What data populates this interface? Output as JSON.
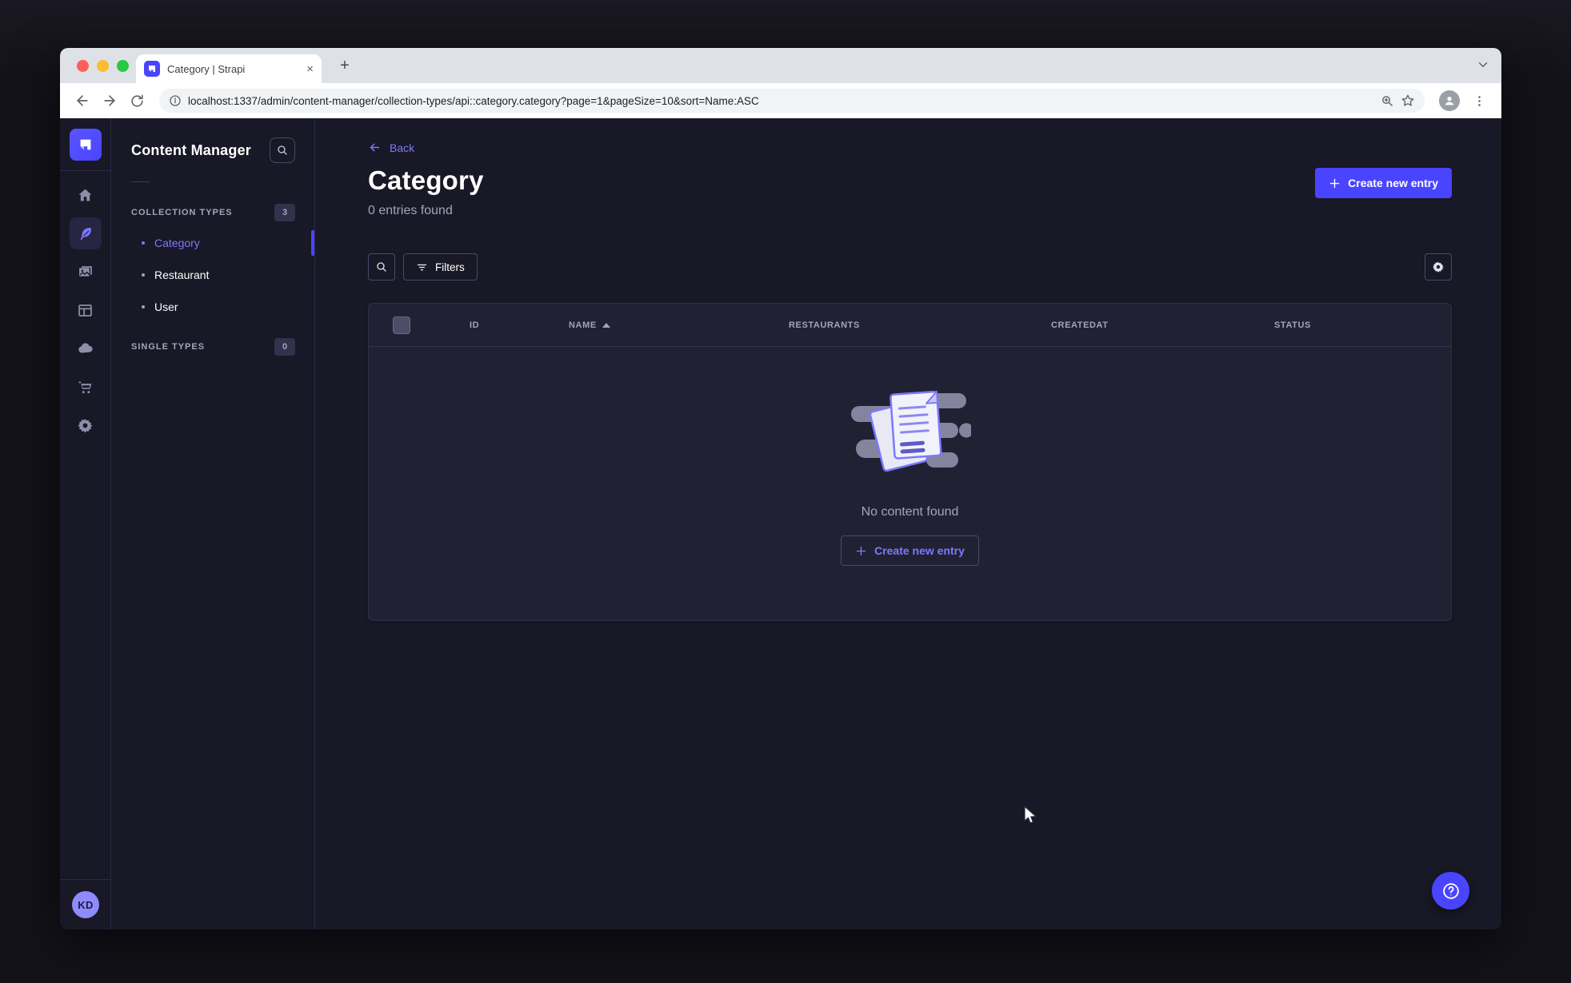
{
  "browser": {
    "tab_title": "Category | Strapi",
    "tab_close": "×",
    "new_tab": "+",
    "url": "localhost:1337/admin/content-manager/collection-types/api::category.category?page=1&pageSize=10&sort=Name:ASC"
  },
  "sidebar": {
    "icons": [
      "strapi-logo",
      "home",
      "content-manager",
      "media-library",
      "content-type-builder",
      "cloud",
      "marketplace",
      "settings"
    ],
    "user_initials": "KD"
  },
  "subnav": {
    "title": "Content Manager",
    "collection_types": {
      "label": "COLLECTION TYPES",
      "count": "3",
      "items": [
        {
          "label": "Category",
          "active": true
        },
        {
          "label": "Restaurant",
          "active": false
        },
        {
          "label": "User",
          "active": false
        }
      ]
    },
    "single_types": {
      "label": "SINGLE TYPES",
      "count": "0"
    }
  },
  "main": {
    "back_label": "Back",
    "title": "Category",
    "entries_count": "0 entries found",
    "create_button_label": "Create new entry",
    "filters_label": "Filters",
    "table_headers": [
      "ID",
      "NAME",
      "RESTAURANTS",
      "CREATEDAT",
      "STATUS"
    ],
    "sort": {
      "column": "NAME",
      "direction": "ASC"
    },
    "empty_state": {
      "message": "No content found",
      "create_button_label": "Create new entry"
    }
  },
  "help_label": "?",
  "colors": {
    "primary": "#4945ff",
    "primary_text": "#7b79ff",
    "app_background": "#181826",
    "surface": "#212134",
    "border": "#32324d",
    "muted_text": "#a5a5ba"
  }
}
